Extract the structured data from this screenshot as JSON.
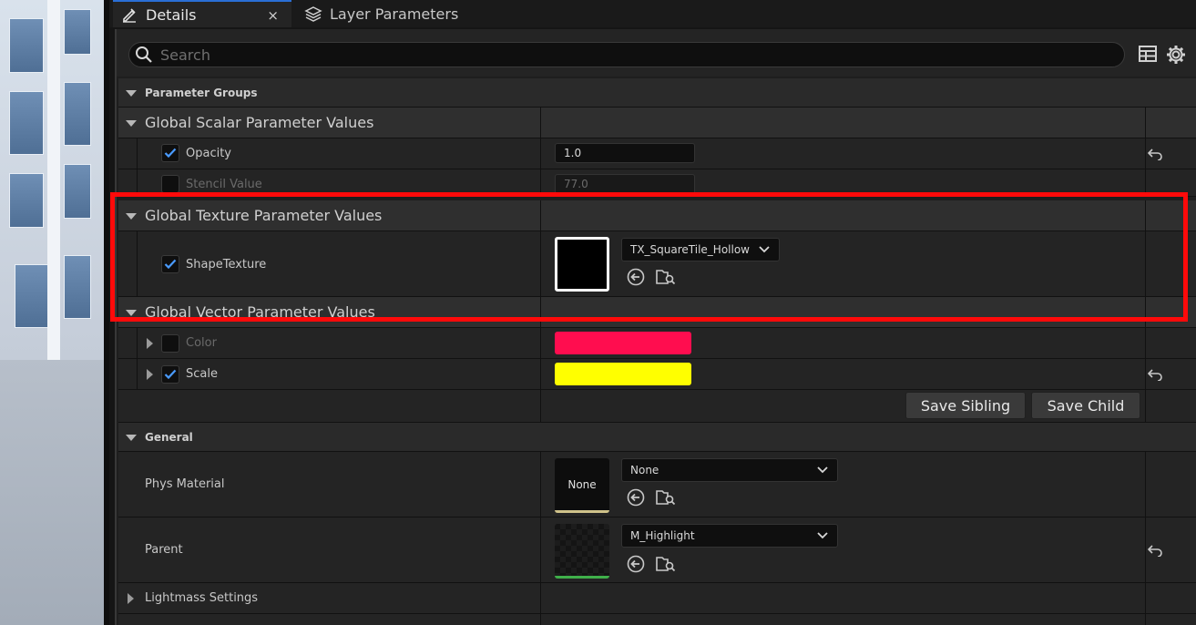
{
  "tabs": {
    "details": "Details",
    "close": "×",
    "layer_parameters": "Layer Parameters"
  },
  "search": {
    "placeholder": "Search"
  },
  "groups": {
    "parameter_groups": "Parameter Groups",
    "global_scalar": "Global Scalar Parameter Values",
    "global_texture": "Global Texture Parameter Values",
    "global_vector": "Global Vector Parameter Values",
    "general": "General",
    "lightmass": "Lightmass Settings"
  },
  "scalar": {
    "opacity_label": "Opacity",
    "opacity_value": "1.0",
    "stencil_label": "Stencil Value",
    "stencil_value": "77.0"
  },
  "texture": {
    "shape_label": "ShapeTexture",
    "shape_asset": "TX_SquareTile_Hollow"
  },
  "vector": {
    "color_label": "Color",
    "color_value": "#ff0d4f",
    "scale_label": "Scale",
    "scale_value": "#ffff00"
  },
  "buttons": {
    "save_sibling": "Save Sibling",
    "save_child": "Save Child"
  },
  "general": {
    "phys_label": "Phys Material",
    "phys_thumb": "None",
    "phys_value": "None",
    "parent_label": "Parent",
    "parent_value": "M_Highlight"
  },
  "colors": {
    "accent": "#2a6fd6",
    "highlight_box": "#ff0a0a",
    "checkbox_check": "#4a9bff"
  }
}
